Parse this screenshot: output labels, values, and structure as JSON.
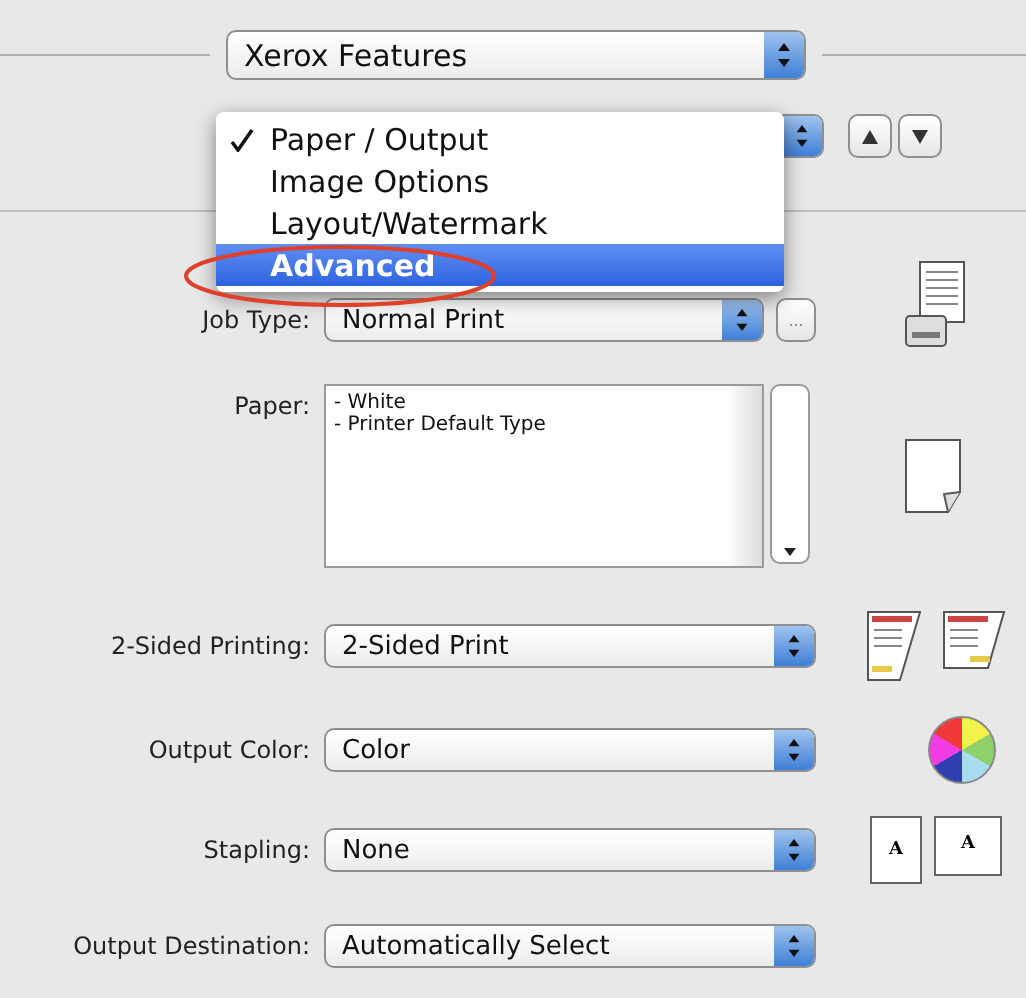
{
  "feature_popup": {
    "value": "Xerox Features"
  },
  "menu": {
    "items": [
      {
        "label": "Paper / Output",
        "checked": true,
        "highlighted": false
      },
      {
        "label": "Image Options",
        "checked": false,
        "highlighted": false
      },
      {
        "label": "Layout/Watermark",
        "checked": false,
        "highlighted": false
      },
      {
        "label": "Advanced",
        "checked": false,
        "highlighted": true
      }
    ]
  },
  "more_button": {
    "label": "..."
  },
  "rows": [
    {
      "kind": "jobtype",
      "label": "Job Type:",
      "value": "Normal Print"
    },
    {
      "kind": "paper",
      "label": "Paper:",
      "lines": [
        "- White",
        "- Printer Default Type"
      ]
    },
    {
      "kind": "duplex",
      "label": "2-Sided Printing:",
      "value": "2-Sided Print"
    },
    {
      "kind": "color",
      "label": "Output Color:",
      "value": "Color"
    },
    {
      "kind": "stapling",
      "label": "Stapling:",
      "value": "None"
    },
    {
      "kind": "destination",
      "label": "Output Destination:",
      "value": "Automatically Select"
    }
  ],
  "staple_previews": [
    "A",
    "A"
  ]
}
